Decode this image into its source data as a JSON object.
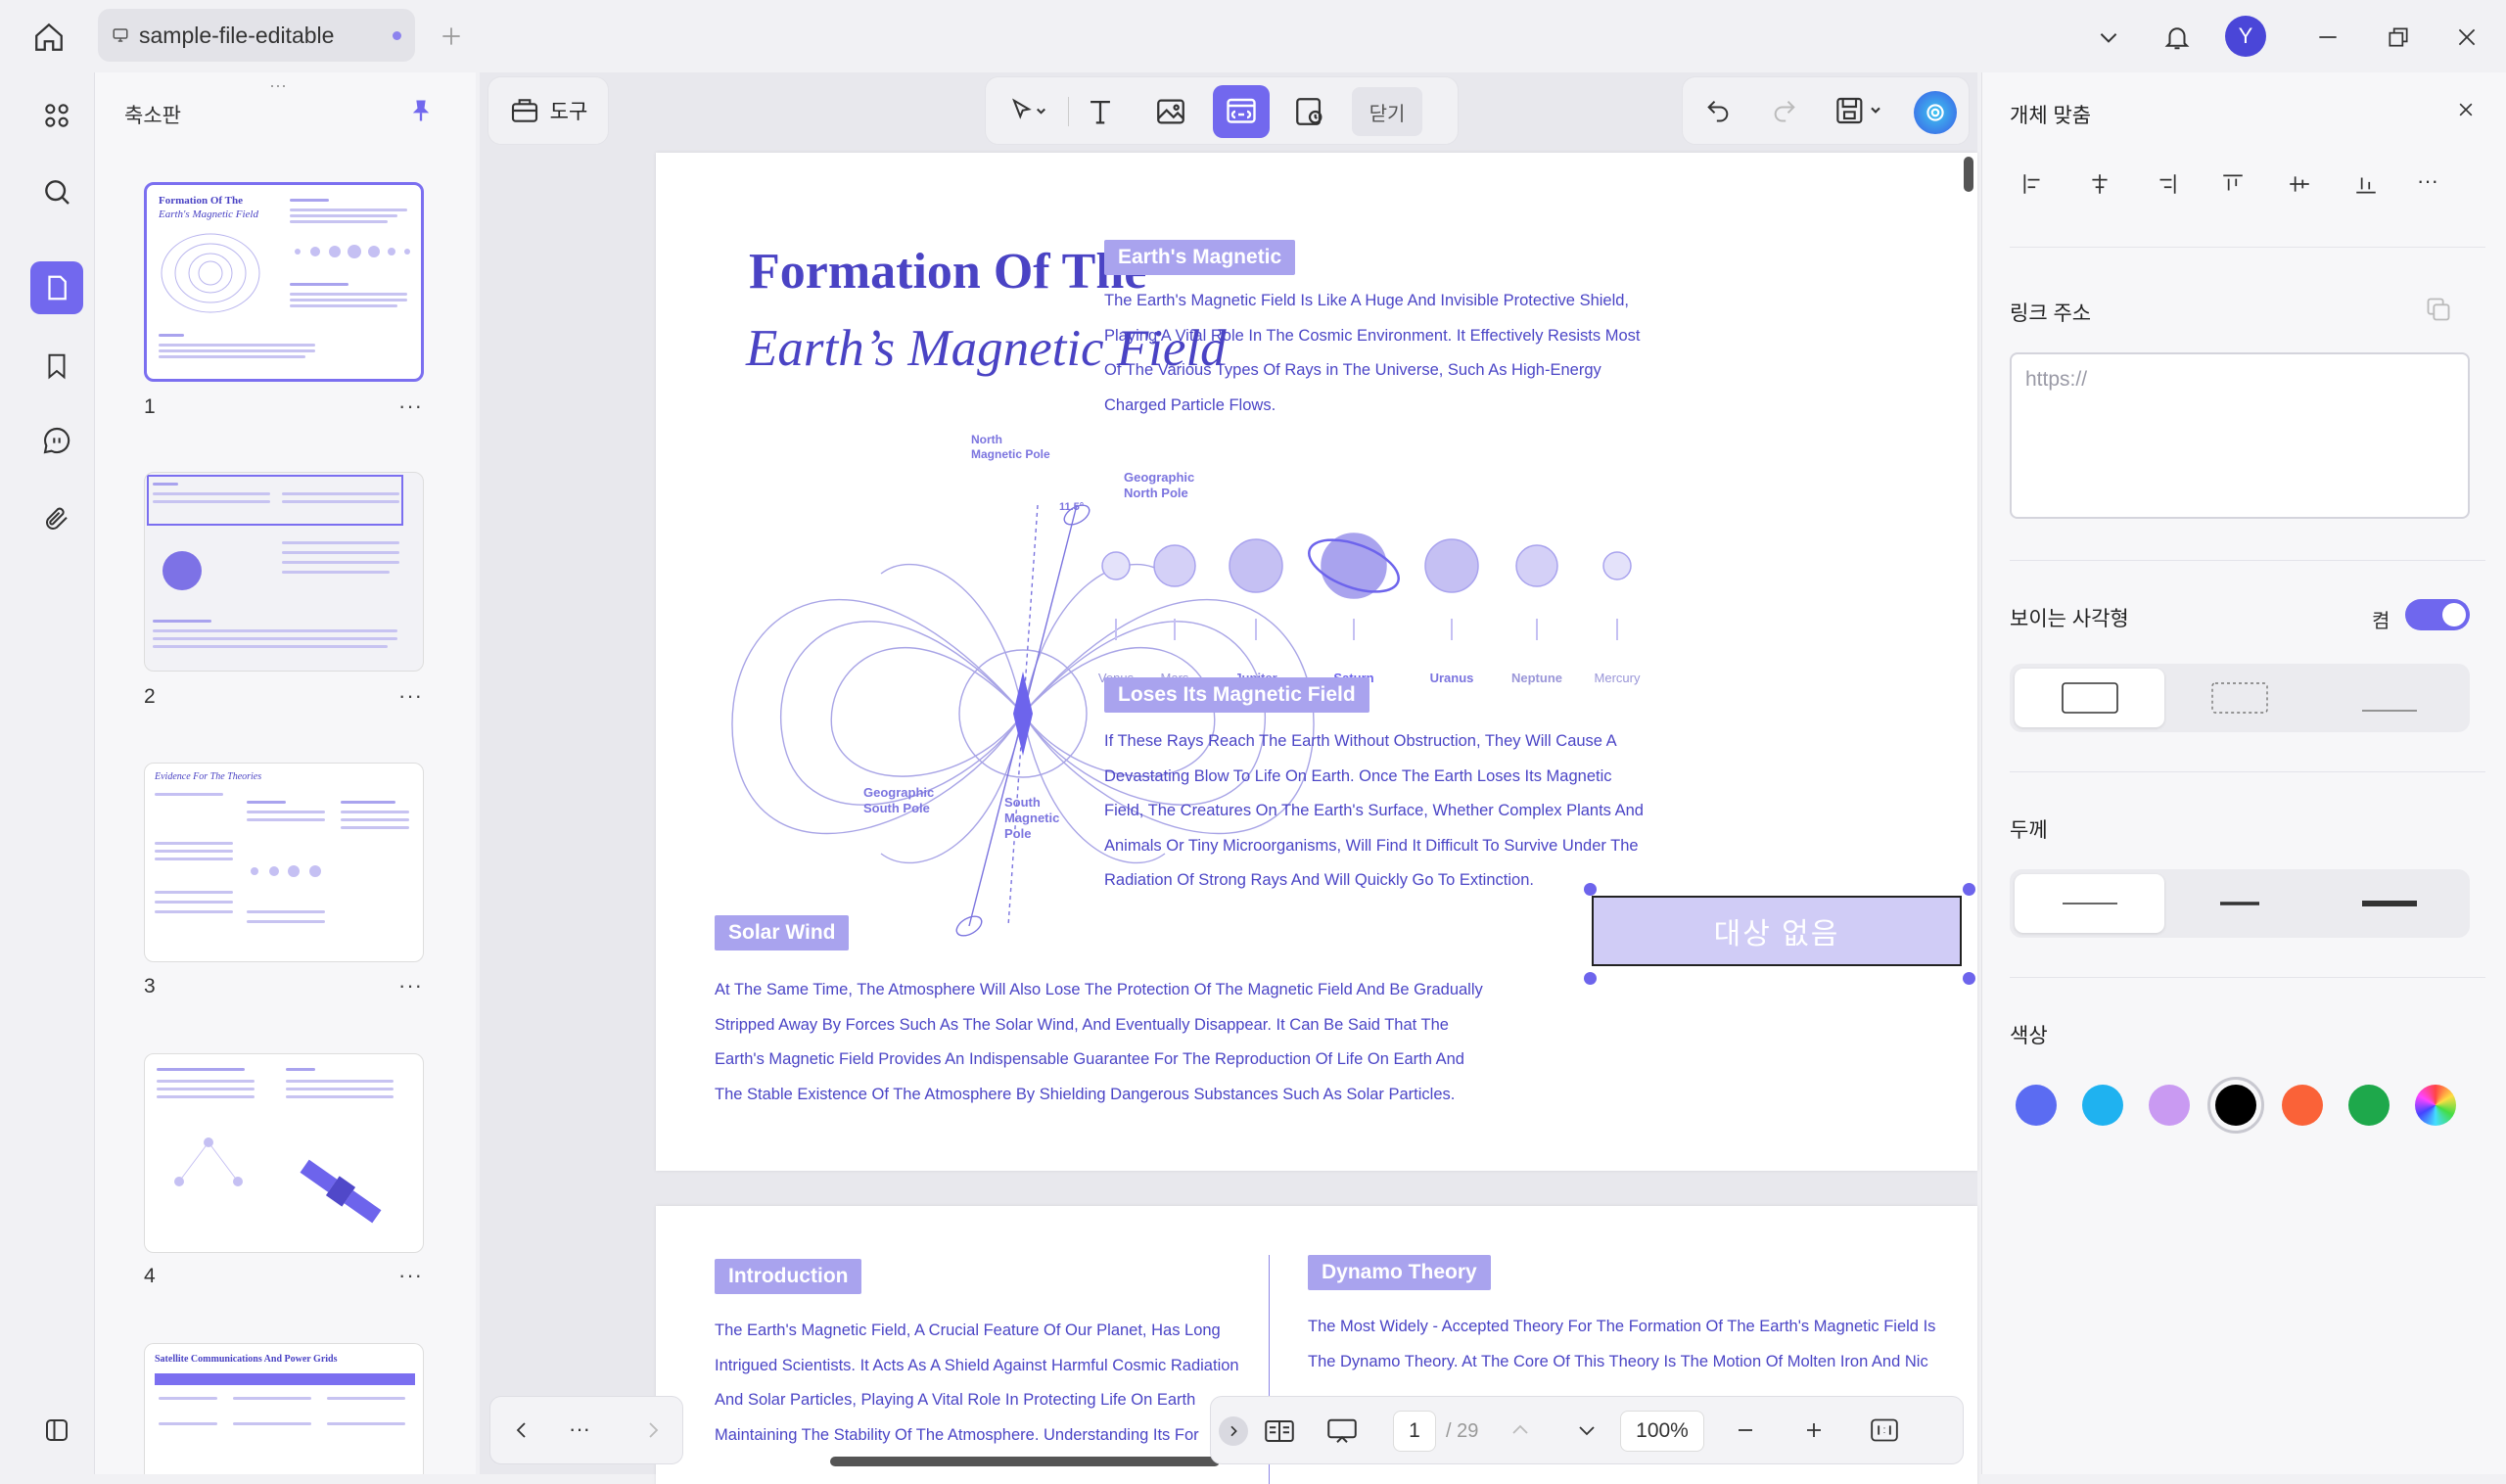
{
  "titlebar": {
    "tab_title": "sample-file-editable",
    "avatar_letter": "Y",
    "new_tab_icon": "plus-icon"
  },
  "sidebar": {
    "title": "축소판",
    "pages": [
      {
        "num": "1",
        "more": "···"
      },
      {
        "num": "2",
        "more": "···"
      },
      {
        "num": "3",
        "more": "···"
      },
      {
        "num": "4",
        "more": "···"
      }
    ]
  },
  "toolbar": {
    "tools_label": "도구",
    "close_label": "닫기"
  },
  "document": {
    "title_line1": "Formation Of The",
    "title_line2": "Earth’s Magnetic Field",
    "earths_magnetic": {
      "heading": "Earth's Magnetic",
      "lines": [
        "The Earth's Magnetic Field Is Like A Huge And Invisible Protective Shield,",
        "Playing A Vital Role In The Cosmic Environment. It Effectively Resists Most",
        "Of The Various Types Of Rays in The Universe, Such As High-Energy",
        "Charged Particle Flows."
      ]
    },
    "planets": [
      "Venus",
      "Mars",
      "Jupiter",
      "Saturn",
      "Uranus",
      "Neptune",
      "Mercury"
    ],
    "diagram_labels": {
      "north_magnetic": "North\nMagnetic Pole",
      "geo_north": "Geographic\nNorth Pole",
      "geo_south": "Geographic\nSouth Pole",
      "south_magnetic": "South\nMagnetic\nPole",
      "angle": "11.5°"
    },
    "loses": {
      "heading": "Loses Its Magnetic Field",
      "lines": [
        "If These Rays Reach The Earth Without Obstruction, They Will Cause A",
        "Devastating Blow To Life On Earth. Once The Earth Loses Its Magnetic",
        "Field, The Creatures On The Earth's Surface, Whether Complex Plants And",
        "Animals Or Tiny Microorganisms, Will Find It Difficult To Survive Under The",
        "Radiation Of Strong Rays And Will Quickly Go To Extinction."
      ]
    },
    "selection_label": "대상 없음",
    "solar_wind": {
      "heading": "Solar Wind",
      "lines": [
        "At The Same Time, The Atmosphere Will Also Lose The Protection Of The Magnetic Field And Be Gradually",
        "Stripped Away By Forces Such As The Solar Wind, And Eventually Disappear. It Can Be Said That The",
        "Earth's Magnetic Field Provides An Indispensable Guarantee For The Reproduction Of Life On Earth And",
        "The Stable Existence Of The Atmosphere By Shielding Dangerous Substances Such As Solar Particles."
      ]
    },
    "introduction": {
      "heading": "Introduction",
      "lines": [
        "The Earth's Magnetic Field, A Crucial Feature Of Our Planet, Has Long",
        "Intrigued Scientists. It Acts As A Shield Against Harmful Cosmic Radiation",
        "And Solar Particles, Playing A Vital Role In Protecting Life On Earth",
        "Maintaining The Stability Of The Atmosphere. Understanding Its For"
      ]
    },
    "dynamo": {
      "heading": "Dynamo Theory",
      "lines": [
        "The Most Widely - Accepted Theory For The Formation Of The Earth's Magnetic Field Is",
        "The Dynamo Theory. At The Core Of This Theory Is The Motion Of Molten Iron And Nic"
      ]
    }
  },
  "bottombar": {
    "nav_more": "···",
    "page_current": "1",
    "page_total": "/ 29",
    "zoom": "100%"
  },
  "right_panel": {
    "title": "개체 맞춤",
    "align_more": "···",
    "link_label": "링크 주소",
    "link_placeholder": "https://",
    "visible_rect_label": "보이는 사각형",
    "toggle_state": "켬",
    "thickness_label": "두께",
    "color_label": "색상",
    "colors": [
      "#5b6cf2",
      "#1fb2f0",
      "#c99af2",
      "#000000",
      "#fa6238",
      "#1ea84b"
    ],
    "selected_color": "#000000"
  }
}
